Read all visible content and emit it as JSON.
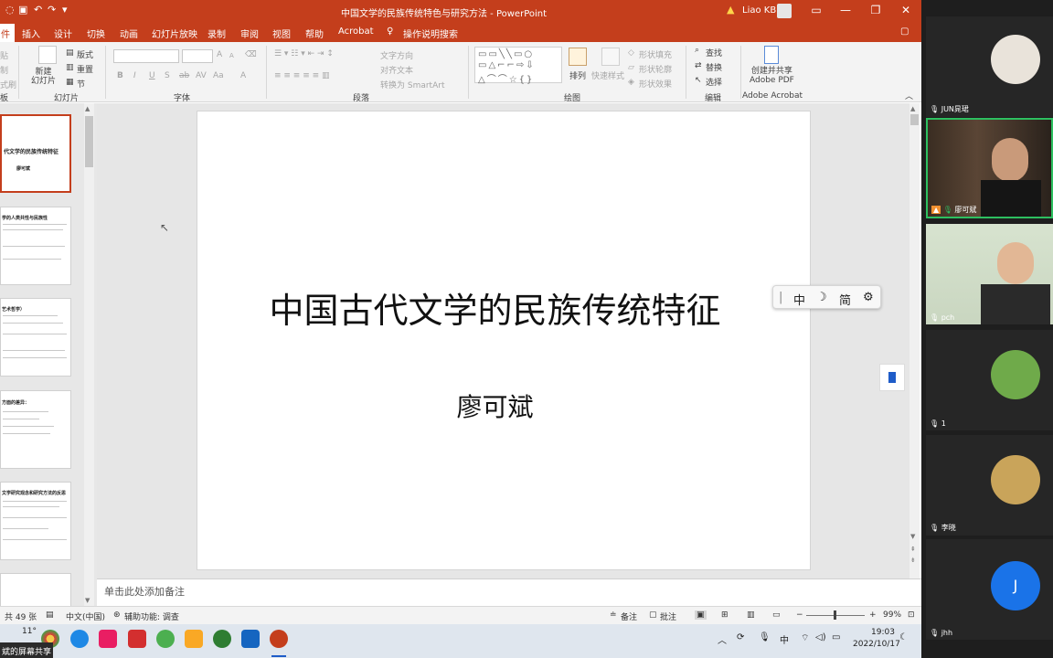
{
  "window": {
    "title": "中国文学的民族传统特色与研究方法 - PowerPoint",
    "user": "Liao KB",
    "warning_icon": "warning-icon"
  },
  "tabs": [
    "件",
    "插入",
    "设计",
    "切换",
    "动画",
    "幻灯片放映",
    "录制",
    "审阅",
    "视图",
    "帮助",
    "Acrobat"
  ],
  "tell_me": "操作说明搜索",
  "ribbon": {
    "slides_group": {
      "new_slide": "新建\n幻灯片",
      "layout": "版式",
      "reset": "重置",
      "section": "节",
      "label": "幻灯片"
    },
    "font_group": {
      "label": "字体",
      "bold": "B",
      "italic": "I",
      "underline": "U",
      "strike": "S",
      "shadow": "ab",
      "spacing": "AV",
      "case": "Aa",
      "grow": "A",
      "shrink": "A"
    },
    "paragraph_group": {
      "label": "段落",
      "text_direction": "文字方向",
      "align_text": "对齐文本",
      "smartart": "转换为 SmartArt"
    },
    "drawing_group": {
      "label": "绘图",
      "arrange": "排列",
      "quick_styles": "快速样式",
      "fill": "形状填充",
      "outline": "形状轮廓",
      "effects": "形状效果"
    },
    "editing_group": {
      "label": "编辑",
      "find": "查找",
      "replace": "替换",
      "select": "选择"
    },
    "acrobat_group": {
      "label": "Adobe Acrobat",
      "create": "创建并共享\nAdobe PDF"
    },
    "left_partial": {
      "a": "贴",
      "b": "制",
      "c": "式刷",
      "d": "板"
    }
  },
  "slide": {
    "title": "中国古代文学的民族传统特征",
    "author": "廖可斌"
  },
  "thumbnails": [
    {
      "title": "代文学的民族传统特征",
      "sub": "廖可斌"
    },
    {
      "title": "学的人类共性与民族性"
    },
    {
      "title": "艺术哲学）"
    },
    {
      "title": "方面的差异："
    },
    {
      "title": "文学研究观念和研究方法的反思"
    },
    {
      "title": ""
    }
  ],
  "ime_toolbar": {
    "mode": "中",
    "moon": "☽",
    "simplified": "简",
    "settings_icon": "gear-icon"
  },
  "notes_placeholder": "单击此处添加备注",
  "status": {
    "slide_count": "共 49 张",
    "language": "中文(中国)",
    "accessibility": "辅助功能: 调查",
    "notes": "备注",
    "comments": "批注",
    "zoom": "99%"
  },
  "taskbar": {
    "weather": "11°",
    "clock_time": "19:03",
    "clock_date": "2022/10/17",
    "ime": "中",
    "share_banner": "斌的屏幕共享"
  },
  "participants": [
    {
      "name": "JUN晁珺"
    },
    {
      "name": "廖可斌"
    },
    {
      "name": "pch"
    },
    {
      "name": "1"
    },
    {
      "name": "李晓"
    },
    {
      "name": "jhh",
      "initial": "J"
    }
  ],
  "colors": {
    "ppt_accent": "#c43e1c",
    "speaking": "#2dbf60",
    "avatar_blue": "#1a73e8"
  }
}
